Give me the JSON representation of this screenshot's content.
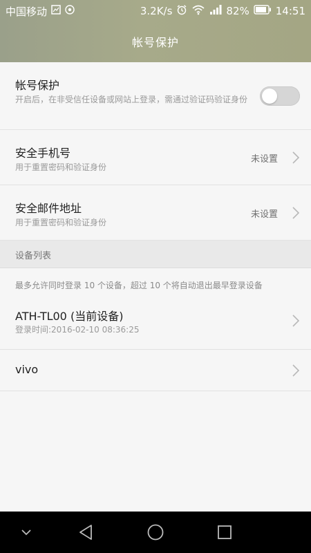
{
  "status_bar": {
    "carrier": "中国移动",
    "net_speed": "3.2K/s",
    "battery": "82%",
    "time": "14:51"
  },
  "header": {
    "title": "帐号保护"
  },
  "account_protection": {
    "label": "帐号保护",
    "description": "开启后，在非受信任设备或网站上登录，需通过验证码验证身份",
    "enabled": false
  },
  "security_phone": {
    "label": "安全手机号",
    "description": "用于重置密码和验证身份",
    "value": "未设置"
  },
  "security_email": {
    "label": "安全邮件地址",
    "description": "用于重置密码和验证身份",
    "value": "未设置"
  },
  "devices": {
    "section_title": "设备列表",
    "info": "最多允许同时登录 10 个设备，超过 10 个将自动退出最早登录设备",
    "items": [
      {
        "name": "ATH-TL00 (当前设备)",
        "login_time": "登录时间:2016-02-10 08:36:25"
      },
      {
        "name": "vivo",
        "login_time": ""
      }
    ]
  },
  "icons": {
    "chevron": "chevron-right-icon",
    "back": "back-triangle-icon",
    "home": "home-circle-icon",
    "recent": "recent-square-icon",
    "dismiss": "chevron-down-icon"
  }
}
